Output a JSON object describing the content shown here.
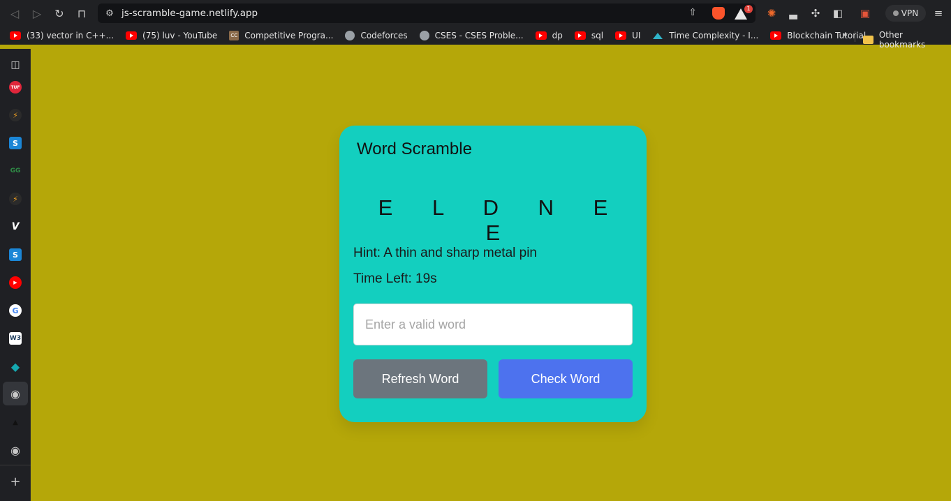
{
  "browser": {
    "url": "js-scramble-game.netlify.app",
    "shield_badge": "1",
    "vpn_label": "VPN"
  },
  "bookmarks": {
    "items": [
      {
        "label": "(33) vector in C++...",
        "icon": "youtube-icon"
      },
      {
        "label": "(75) luv - YouTube",
        "icon": "youtube-icon"
      },
      {
        "label": "Competitive Progra...",
        "icon": "cc-icon"
      },
      {
        "label": "Codeforces",
        "icon": "globe-icon"
      },
      {
        "label": "CSES - CSES Proble...",
        "icon": "globe-icon"
      },
      {
        "label": "dp",
        "icon": "youtube-icon"
      },
      {
        "label": "sql",
        "icon": "youtube-icon"
      },
      {
        "label": "UI",
        "icon": "youtube-icon"
      },
      {
        "label": "Time Complexity - I...",
        "icon": "mountain-icon"
      },
      {
        "label": "Blockchain Tutorial...",
        "icon": "youtube-icon"
      }
    ],
    "more": "»",
    "other": "Other bookmarks"
  },
  "sidebar": {
    "items": [
      {
        "name": "sidebar-panel-icon",
        "glyph": "▯",
        "color": "#d0d0d0"
      },
      {
        "name": "tuf-icon",
        "glyph": "TUF",
        "color": "#e0263b"
      },
      {
        "name": "codolio-icon",
        "glyph": "⚡",
        "color": "#2b2b2b"
      },
      {
        "name": "s-icon",
        "glyph": "S",
        "color": "#1b86d6"
      },
      {
        "name": "gfg-icon",
        "glyph": "GG",
        "color": "#1f2024"
      },
      {
        "name": "codolio-icon-2",
        "glyph": "⚡",
        "color": "#2b2b2b"
      },
      {
        "name": "v-icon",
        "glyph": "V",
        "color": "#1f2024"
      },
      {
        "name": "s-icon-2",
        "glyph": "S",
        "color": "#1b86d6"
      },
      {
        "name": "youtube-icon",
        "glyph": "▶",
        "color": "#ff0000"
      },
      {
        "name": "google-icon",
        "glyph": "G",
        "color": "#ffffff"
      },
      {
        "name": "w3-icon",
        "glyph": "W3",
        "color": "#ffffff"
      },
      {
        "name": "diamond-icon",
        "glyph": "◆",
        "color": "#1f2024"
      },
      {
        "name": "globe-icon",
        "glyph": "●",
        "color": "#1f2024"
      },
      {
        "name": "alien-icon",
        "glyph": "▲",
        "color": "#1f2024"
      },
      {
        "name": "globe-icon-2",
        "glyph": "●",
        "color": "#1f2024"
      },
      {
        "name": "add-icon",
        "glyph": "+",
        "color": "#1f2024"
      }
    ]
  },
  "game": {
    "title": "Word Scramble",
    "scrambled_word": "E L D N E E",
    "hint_label": "Hint: A thin and sharp metal pin",
    "time_label": "Time Left: 19s",
    "input_placeholder": "Enter a valid word",
    "input_value": "",
    "refresh_label": "Refresh Word",
    "check_label": "Check Word"
  },
  "colors": {
    "page_bg": "#b5a709",
    "card_bg": "#13cfbf",
    "refresh_btn": "#6c757d",
    "check_btn": "#4d72ee"
  }
}
